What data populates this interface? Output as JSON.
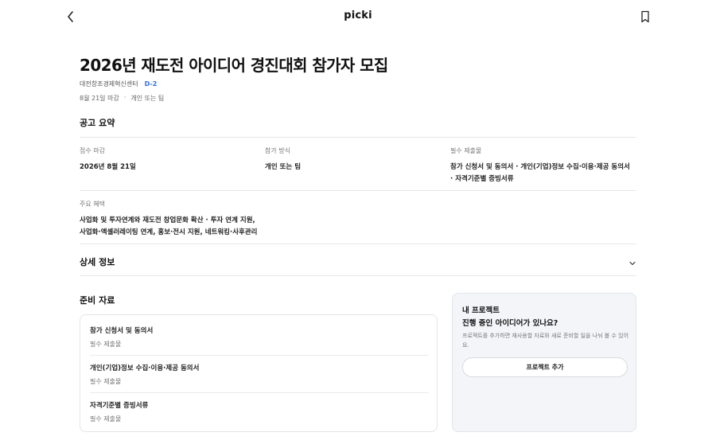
{
  "header": {
    "logo": "picki",
    "back_icon": "chevron-left-icon",
    "bookmark_icon": "bookmark-icon"
  },
  "notice": {
    "title": "2026년 재도전 아이디어 경진대회 참가자 모집",
    "organizer": "대전창조경제혁신센터",
    "dday": "D-2",
    "deadline": "8월 21일 마감",
    "separator": "·",
    "participation": "개인 또는 팀"
  },
  "summary": {
    "heading": "공고 요약",
    "items": [
      {
        "label": "접수 마감",
        "value": "2026년 8월 21일"
      },
      {
        "label": "참가 방식",
        "value": "개인 또는 팀"
      },
      {
        "label": "필수 제출물",
        "lines": [
          "참가 신청서 및 동의서 · 개인(기업)정보 수집·이용·제공 동의서",
          "· 자격기준별 증빙서류"
        ]
      }
    ],
    "benefits": {
      "label": "주요 혜택",
      "lines": [
        "사업화 및 투자연계와 재도전 창업문화 확산 · 투자 연계 지원,",
        "사업화·액셀러레이팅 연계, 홍보·전시 지원, 네트워킹·사후관리"
      ]
    }
  },
  "detail": {
    "heading": "상세 정보",
    "icon": "chevron-down-icon"
  },
  "materials": {
    "heading": "준비 자료",
    "items": [
      {
        "name": "참가 신청서 및 동의서",
        "sub": "필수 제출물"
      },
      {
        "name": "개인(기업)정보 수집·이용·제공 동의서",
        "sub": "필수 제출물"
      },
      {
        "name": "자격기준별 증빙서류",
        "sub": "필수 제출물"
      }
    ]
  },
  "project_card": {
    "title": "내 프로젝트",
    "subtitle": "진행 중인 아이디어가 있나요?",
    "description": "프로젝트를 추가하면 재사용할 자료와 새로 준비할 일을 나눠 볼 수 있어요.",
    "button_label": "프로젝트 추가"
  },
  "colors": {
    "accent": "#2f6be6",
    "card_bg": "#f3f5f8",
    "divider": "#e6e7ea"
  }
}
